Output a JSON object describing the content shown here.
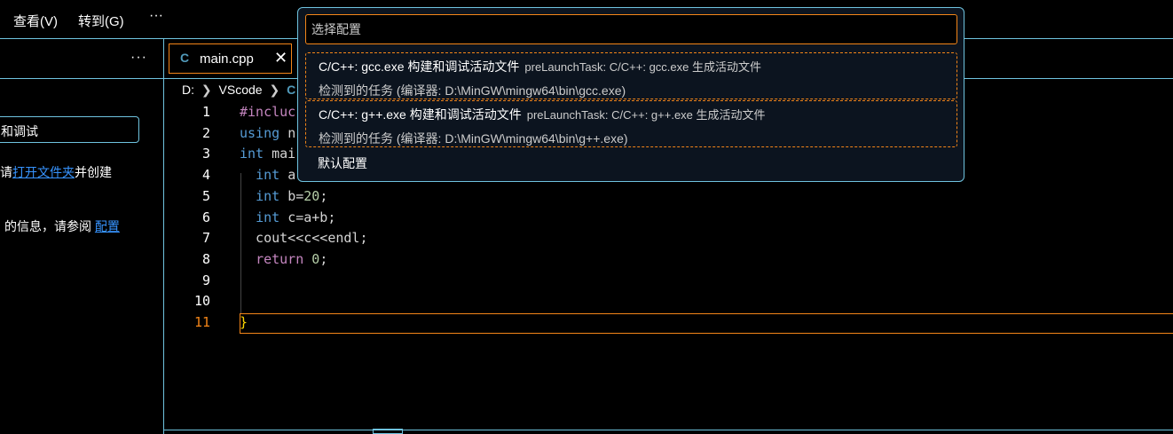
{
  "menubar": {
    "items": [
      "查看(V)",
      "转到(G)"
    ],
    "more": "···"
  },
  "sidebar": {
    "more": "···",
    "button_label": "和调试",
    "text1_prefix": "请",
    "text1_link": "打开文件夹",
    "text1_suffix": "并创建",
    "text2_prefix": "的信息，请参阅",
    "text2_link": "配置"
  },
  "tab": {
    "icon": "C",
    "label": "main.cpp",
    "close": "✕"
  },
  "breadcrumbs": {
    "drive": "D:",
    "folder": "VScode",
    "icon": "C"
  },
  "editor": {
    "line_numbers": [
      "1",
      "2",
      "3",
      "4",
      "5",
      "6",
      "7",
      "8",
      "9",
      "10",
      "11"
    ],
    "lines": [
      {
        "parts": [
          {
            "t": "#incluc",
            "c": "pp"
          }
        ]
      },
      {
        "parts": [
          {
            "t": "using ",
            "c": "kw"
          },
          {
            "t": "n",
            "c": ""
          }
        ]
      },
      {
        "parts": [
          {
            "t": "int ",
            "c": "kw"
          },
          {
            "t": "mai",
            "c": ""
          }
        ]
      },
      {
        "parts": [
          {
            "t": "  ",
            "c": ""
          },
          {
            "t": "int ",
            "c": "kw"
          },
          {
            "t": "a",
            "c": ""
          }
        ]
      },
      {
        "parts": [
          {
            "t": "  ",
            "c": ""
          },
          {
            "t": "int ",
            "c": "kw"
          },
          {
            "t": "b=",
            "c": ""
          },
          {
            "t": "20",
            "c": "num"
          },
          {
            "t": ";",
            "c": ""
          }
        ]
      },
      {
        "parts": [
          {
            "t": "  ",
            "c": ""
          },
          {
            "t": "int ",
            "c": "kw"
          },
          {
            "t": "c=a+b;",
            "c": ""
          }
        ]
      },
      {
        "parts": [
          {
            "t": "  cout<<c<<endl;",
            "c": ""
          }
        ]
      },
      {
        "parts": [
          {
            "t": "  ",
            "c": ""
          },
          {
            "t": "return ",
            "c": "pp"
          },
          {
            "t": "0",
            "c": "num"
          },
          {
            "t": ";",
            "c": ""
          }
        ]
      },
      {
        "parts": [
          {
            "t": "",
            "c": ""
          }
        ]
      },
      {
        "parts": [
          {
            "t": "",
            "c": ""
          }
        ]
      },
      {
        "parts": [
          {
            "t": "}",
            "c": "brace"
          }
        ]
      }
    ],
    "active_line": 11
  },
  "quick_pick": {
    "placeholder": "选择配置",
    "items": [
      {
        "label": "C/C++: gcc.exe 构建和调试活动文件",
        "description": "preLaunchTask: C/C++: gcc.exe 生成活动文件",
        "detail": "检测到的任务 (编译器: D:\\MinGW\\mingw64\\bin\\gcc.exe)"
      },
      {
        "label": "C/C++: g++.exe 构建和调试活动文件",
        "description": "preLaunchTask: C/C++: g++.exe 生成活动文件",
        "detail": "检测到的任务 (编译器: D:\\MinGW\\mingw64\\bin\\g++.exe)"
      }
    ],
    "default_label": "默认配置"
  },
  "colors": {
    "focus_border": "#f38518",
    "contrast_border": "#6fc3df",
    "link": "#3794ff"
  }
}
